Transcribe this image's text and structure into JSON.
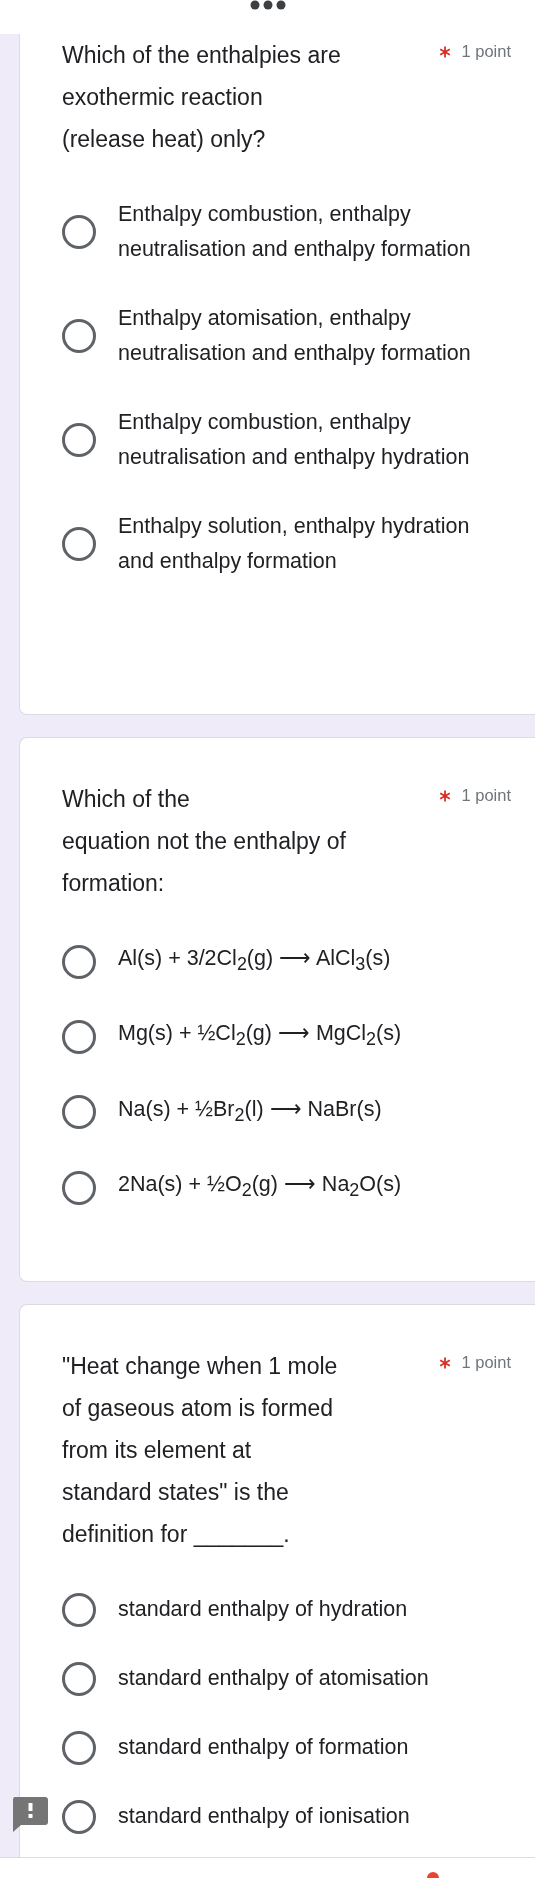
{
  "questions": [
    {
      "title": "Which of the enthalpies are\nexothermic reaction\n(release heat) only?",
      "required": true,
      "points": "1 point",
      "options": [
        {
          "label": "Enthalpy combustion, enthalpy neutralisation and enthalpy formation",
          "selected": false
        },
        {
          "label": "Enthalpy atomisation, enthalpy neutralisation and enthalpy formation",
          "selected": false
        },
        {
          "label": "Enthalpy combustion, enthalpy neutralisation and enthalpy hydration",
          "selected": false
        },
        {
          "label": "Enthalpy solution, enthalpy hydration and enthalpy formation",
          "selected": false
        }
      ]
    },
    {
      "title": "Which of the\nequation not the enthalpy of\nformation:",
      "required": true,
      "points": "1 point",
      "options": [
        {
          "label": "Al(s) + 3/2Cl$_{2}$(g) ⟶ AlCl$_{3}$(s)",
          "selected": false
        },
        {
          "label": "Mg(s) + ½Cl$_{2}$(g) ⟶ MgCl$_{2}$(s)",
          "selected": false
        },
        {
          "label": "Na(s) + ½Br$_{2}$(l) ⟶ NaBr(s)",
          "selected": false
        },
        {
          "label": "2Na(s) + ½O$_{2}$(g) ⟶ Na$_{2}$O(s)",
          "selected": false
        }
      ]
    },
    {
      "title": "\"Heat change when 1 mole\nof gaseous atom is formed\nfrom its element at\nstandard states\" is the\ndefinition for _______.",
      "required": true,
      "points": "1 point",
      "options": [
        {
          "label": "standard enthalpy of hydration",
          "selected": false
        },
        {
          "label": "standard enthalpy of atomisation",
          "selected": false
        },
        {
          "label": "standard enthalpy of formation",
          "selected": false
        },
        {
          "label": "standard enthalpy of ionisation",
          "selected": false
        }
      ]
    }
  ]
}
